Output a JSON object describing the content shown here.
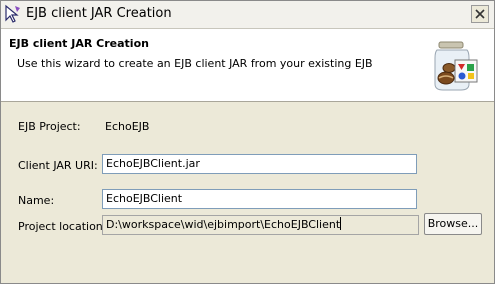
{
  "window": {
    "title": "EJB client JAR Creation"
  },
  "banner": {
    "title": "EJB client JAR Creation",
    "description": "Use this wizard to create an EJB client JAR from your existing EJB"
  },
  "form": {
    "ejb_project_label": "EJB Project:",
    "ejb_project_value": "EchoEJB",
    "client_jar_uri_label": "Client JAR URI:",
    "client_jar_uri_value": "EchoEJBClient.jar",
    "name_label": "Name:",
    "name_value": "EchoEJBClient",
    "project_location_label": "Project location:",
    "project_location_value": "D:\\workspace\\wid\\ejbimport\\EchoEJBClient",
    "browse_label": "Browse..."
  },
  "icons": {
    "title": "wizard-icon",
    "close": "close-icon",
    "banner": "jar-beans-icon"
  },
  "colors": {
    "field_border": "#7f9db9",
    "dialog_bg": "#ece9d8",
    "banner_bg": "#ffffff"
  }
}
